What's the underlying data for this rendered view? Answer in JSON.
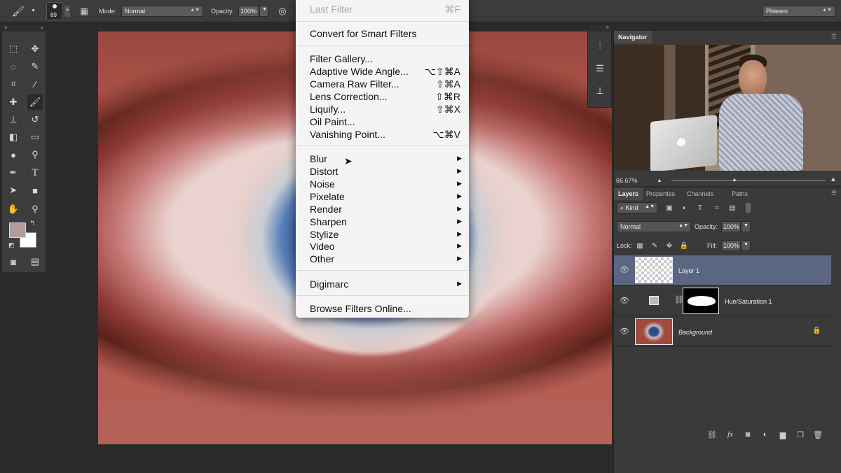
{
  "options_bar": {
    "brush_size": "89",
    "mode_label": "Mode:",
    "mode_value": "Normal",
    "opacity_label": "Opacity:",
    "opacity_value": "100%",
    "workspace": "Phlearn"
  },
  "filter_menu": {
    "items": [
      {
        "label": "Last Filter",
        "shortcut": "⌘F",
        "disabled": true
      },
      {
        "label": "Convert for Smart Filters",
        "shortcut": ""
      },
      {
        "label": "Filter Gallery...",
        "shortcut": ""
      },
      {
        "label": "Adaptive Wide Angle...",
        "shortcut": "⌥⇧⌘A"
      },
      {
        "label": "Camera Raw Filter...",
        "shortcut": "⇧⌘A"
      },
      {
        "label": "Lens Correction...",
        "shortcut": "⇧⌘R"
      },
      {
        "label": "Liquify...",
        "shortcut": "⇧⌘X"
      },
      {
        "label": "Oil Paint...",
        "shortcut": ""
      },
      {
        "label": "Vanishing Point...",
        "shortcut": "⌥⌘V"
      },
      {
        "label": "Blur",
        "submenu": true
      },
      {
        "label": "Distort",
        "submenu": true
      },
      {
        "label": "Noise",
        "submenu": true
      },
      {
        "label": "Pixelate",
        "submenu": true
      },
      {
        "label": "Render",
        "submenu": true
      },
      {
        "label": "Sharpen",
        "submenu": true
      },
      {
        "label": "Stylize",
        "submenu": true
      },
      {
        "label": "Video",
        "submenu": true
      },
      {
        "label": "Other",
        "submenu": true
      },
      {
        "label": "Digimarc",
        "submenu": true
      },
      {
        "label": "Browse Filters Online...",
        "shortcut": ""
      }
    ]
  },
  "navigator": {
    "tab": "Navigator",
    "zoom": "66.67%"
  },
  "layers_panel": {
    "tabs": [
      "Layers",
      "Properties",
      "Channels",
      "Paths"
    ],
    "filter_kind": "Kind",
    "blend_mode": "Normal",
    "opacity_label": "Opacity:",
    "opacity_value": "100%",
    "lock_label": "Lock:",
    "fill_label": "Fill:",
    "fill_value": "100%",
    "layers": [
      {
        "name": "Layer 1",
        "selected": true
      },
      {
        "name": "Hue/Saturation 1",
        "selected": false
      },
      {
        "name": "Background",
        "selected": false,
        "locked": true
      }
    ],
    "bottom_fx": "fx"
  },
  "toolbox": {
    "type_tool_glyph": "T"
  },
  "colors": {
    "foreground": "#b39a9b",
    "background": "#ffffff",
    "selected_layer": "#5b6782"
  }
}
